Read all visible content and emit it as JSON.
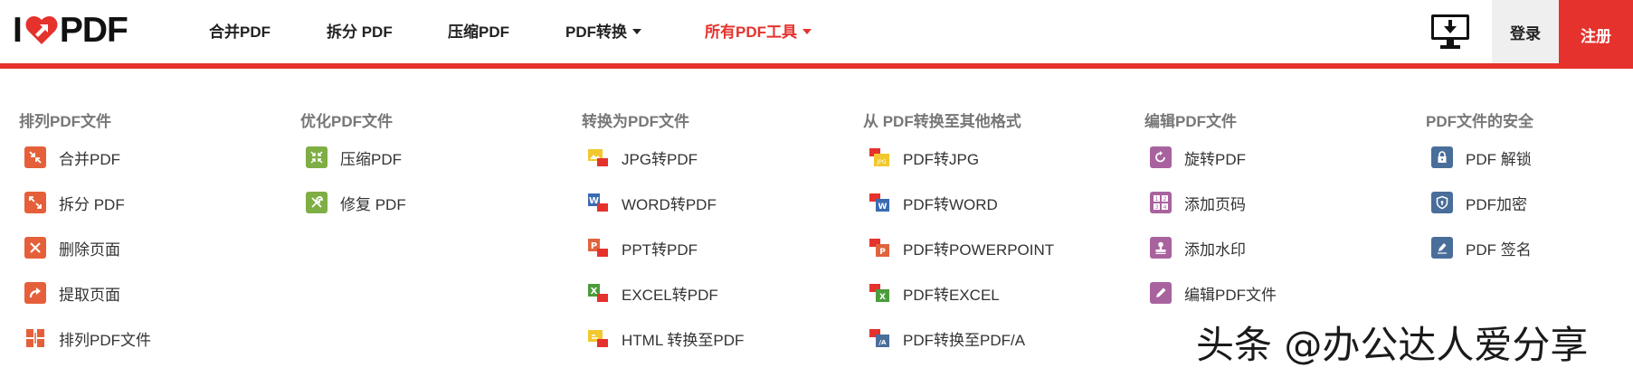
{
  "header": {
    "logo": {
      "left": "I",
      "right": "PDF"
    },
    "nav": [
      {
        "label": "合并PDF",
        "dropdown": false,
        "active": false
      },
      {
        "label": "拆分 PDF",
        "dropdown": false,
        "active": false
      },
      {
        "label": "压缩PDF",
        "dropdown": false,
        "active": false
      },
      {
        "label": "PDF转换",
        "dropdown": true,
        "active": false
      },
      {
        "label": "所有PDF工具",
        "dropdown": true,
        "active": true
      }
    ],
    "login_label": "登录",
    "signup_label": "注册"
  },
  "colors": {
    "brand_red": "#e5322d",
    "nav_active": "#e5322d",
    "merge_orange": "#e5603a",
    "optimize_green": "#7fae45",
    "jpg_yellow": "#f2c82e",
    "word_blue": "#3a6ab0",
    "ppt_orange": "#e0633d",
    "excel_green": "#4c9c3c",
    "edit_purple": "#a8639e",
    "security_blue": "#4a6e9a"
  },
  "menu": [
    {
      "title": "排列PDF文件",
      "items": [
        {
          "label": "合并PDF",
          "icon": "merge-icon"
        },
        {
          "label": "拆分 PDF",
          "icon": "split-icon"
        },
        {
          "label": "删除页面",
          "icon": "delete-pages-icon"
        },
        {
          "label": "提取页面",
          "icon": "extract-pages-icon"
        },
        {
          "label": "排列PDF文件",
          "icon": "organize-icon"
        }
      ]
    },
    {
      "title": "优化PDF文件",
      "items": [
        {
          "label": "压缩PDF",
          "icon": "compress-icon"
        },
        {
          "label": "修复 PDF",
          "icon": "repair-icon"
        }
      ]
    },
    {
      "title": "转换为PDF文件",
      "items": [
        {
          "label": "JPG转PDF",
          "icon": "jpg-to-pdf-icon"
        },
        {
          "label": "WORD转PDF",
          "icon": "word-to-pdf-icon"
        },
        {
          "label": "PPT转PDF",
          "icon": "ppt-to-pdf-icon"
        },
        {
          "label": "EXCEL转PDF",
          "icon": "excel-to-pdf-icon"
        },
        {
          "label": "HTML 转换至PDF",
          "icon": "html-to-pdf-icon"
        }
      ]
    },
    {
      "title": "从 PDF转换至其他格式",
      "items": [
        {
          "label": "PDF转JPG",
          "icon": "pdf-to-jpg-icon"
        },
        {
          "label": "PDF转WORD",
          "icon": "pdf-to-word-icon"
        },
        {
          "label": "PDF转POWERPOINT",
          "icon": "pdf-to-powerpoint-icon"
        },
        {
          "label": "PDF转EXCEL",
          "icon": "pdf-to-excel-icon"
        },
        {
          "label": "PDF转换至PDF/A",
          "icon": "pdf-to-pdfa-icon"
        }
      ]
    },
    {
      "title": "编辑PDF文件",
      "items": [
        {
          "label": "旋转PDF",
          "icon": "rotate-icon"
        },
        {
          "label": "添加页码",
          "icon": "page-numbers-icon"
        },
        {
          "label": "添加水印",
          "icon": "watermark-stamp-icon"
        },
        {
          "label": "编辑PDF文件",
          "icon": "edit-pencil-icon"
        }
      ]
    },
    {
      "title": "PDF文件的安全",
      "items": [
        {
          "label": "PDF 解锁",
          "icon": "unlock-icon"
        },
        {
          "label": "PDF加密",
          "icon": "protect-shield-icon"
        },
        {
          "label": "PDF 签名",
          "icon": "sign-pen-icon"
        }
      ]
    }
  ],
  "watermark_text": "头条 @办公达人爱分享"
}
